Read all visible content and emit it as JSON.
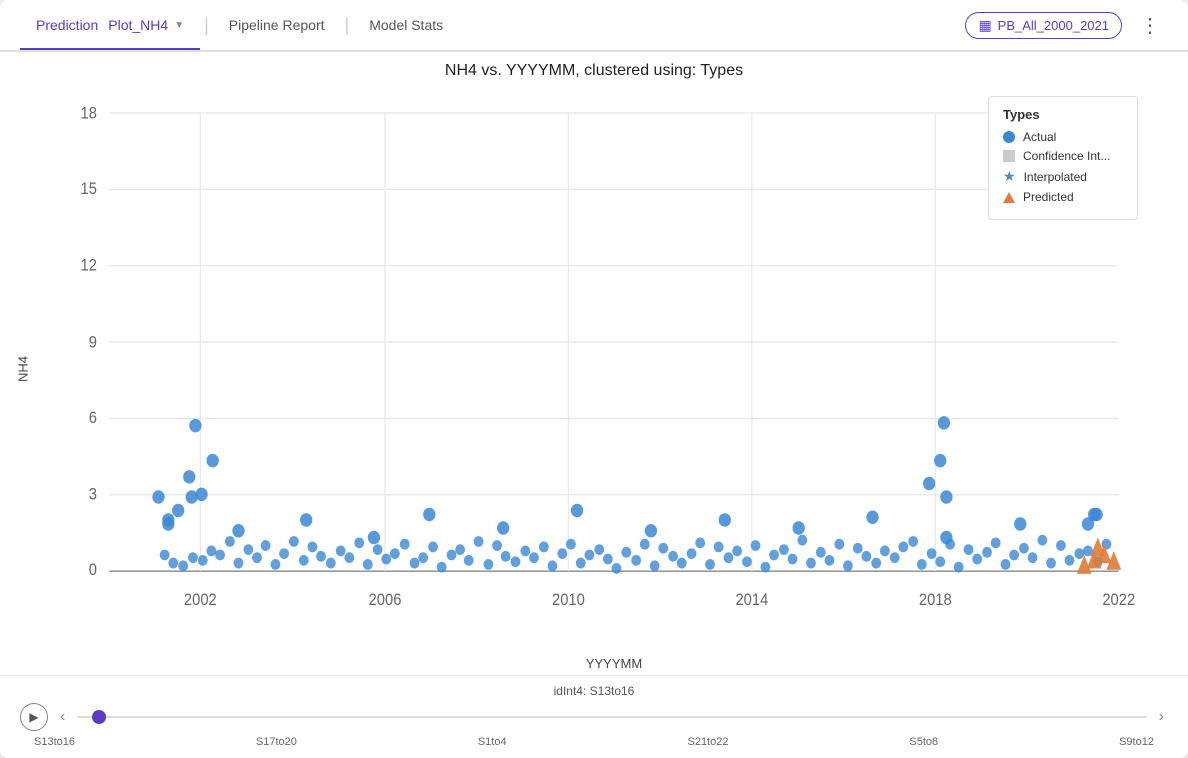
{
  "nav": {
    "active_tab": "Prediction",
    "active_sub": "Plot_NH4",
    "tabs": [
      {
        "label": "Prediction",
        "sub": "Plot_NH4",
        "active": true
      },
      {
        "label": "Pipeline Report",
        "active": false
      },
      {
        "label": "Model Stats",
        "active": false
      }
    ],
    "dataset": "PB_All_2000_2021",
    "more_icon": "⋮"
  },
  "chart": {
    "title": "NH4 vs. YYYYMM, clustered using: Types",
    "y_axis_label": "NH4",
    "x_axis_label": "YYYYMM",
    "y_ticks": [
      0,
      3,
      6,
      9,
      12,
      15,
      18
    ],
    "x_ticks": [
      "2002",
      "2006",
      "2010",
      "2014",
      "2018",
      "2022"
    ],
    "legend": {
      "title": "Types",
      "items": [
        {
          "type": "dot",
          "color": "#3a87d4",
          "label": "Actual"
        },
        {
          "type": "square",
          "color": "#bbb",
          "label": "Confidence Int..."
        },
        {
          "type": "star",
          "color": "#3a87d4",
          "label": "Interpolated"
        },
        {
          "type": "triangle",
          "color": "#e07b3a",
          "label": "Predicted"
        }
      ]
    }
  },
  "slider": {
    "id_label": "idInt4: S13to16",
    "labels": [
      "S13to16",
      "S17to20",
      "S1to4",
      "S21to22",
      "S5to8",
      "S9to12"
    ],
    "thumb_position_pct": 2
  }
}
